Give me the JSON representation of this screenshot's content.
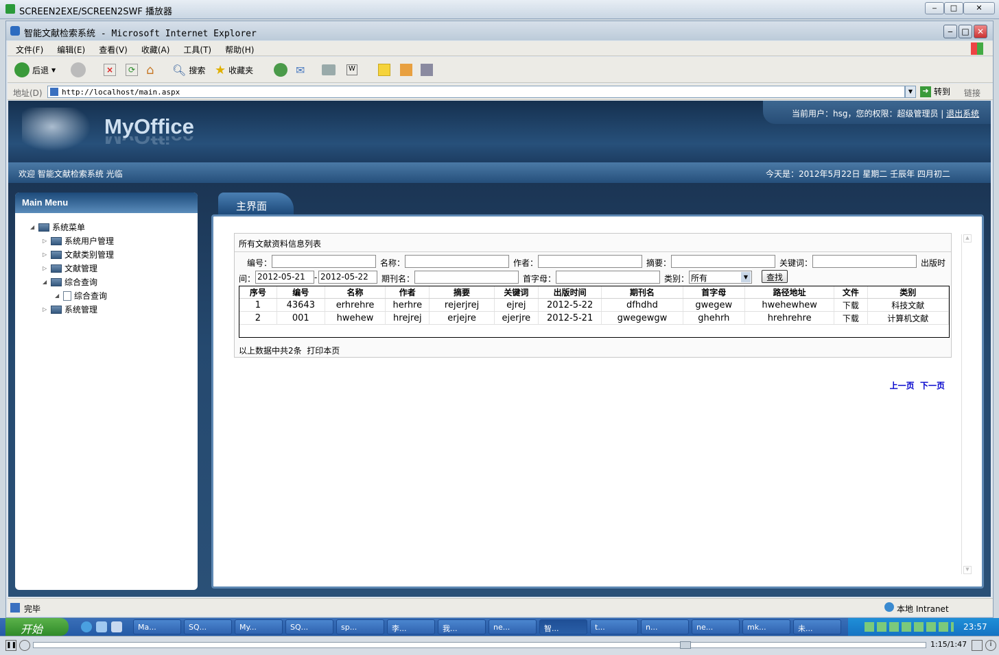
{
  "outer_window": {
    "title": "SCREEN2EXE/SCREEN2SWF 播放器"
  },
  "ie": {
    "title": "智能文献检索系统 - Microsoft Internet Explorer",
    "menu": [
      "文件(F)",
      "编辑(E)",
      "查看(V)",
      "收藏(A)",
      "工具(T)",
      "帮助(H)"
    ],
    "toolbar": {
      "back": "后退",
      "search": "搜索",
      "favorites": "收藏夹"
    },
    "address_label": "地址(D)",
    "url": "http://localhost/main.aspx",
    "go": "转到",
    "links": "链接",
    "status_left": "完毕",
    "status_zone": "本地 Intranet"
  },
  "header": {
    "logo": "MyOffice",
    "user_info": "当前用户：hsg，您的权限：超级管理员",
    "logout": "退出系统",
    "welcome": "欢迎 智能文献检索系统 光临",
    "date": "今天是：2012年5月22日 星期二 壬辰年 四月初二"
  },
  "sidebar": {
    "title": "Main Menu",
    "items": [
      {
        "label": "系统菜单"
      },
      {
        "label": "系统用户管理"
      },
      {
        "label": "文献类别管理"
      },
      {
        "label": "文献管理"
      },
      {
        "label": "综合查询"
      },
      {
        "label": "综合查询"
      },
      {
        "label": "系统管理"
      }
    ]
  },
  "main": {
    "tab": "主界面",
    "panel_title": "所有文献资料信息列表",
    "filters": {
      "id_label": "编号：",
      "name_label": "名称：",
      "author_label": "作者：",
      "abstract_label": "摘要：",
      "keyword_label": "关键词：",
      "pubtime_label": "出版时",
      "pubtime_label2": "间：",
      "date_from": "2012-05-21",
      "date_sep": "-",
      "date_to": "2012-05-22",
      "journal_label": "期刊名：",
      "initial_label": "首字母：",
      "category_label": "类别：",
      "category_value": "所有",
      "search_button": "查找"
    },
    "columns": [
      "序号",
      "编号",
      "名称",
      "作者",
      "摘要",
      "关键词",
      "出版时间",
      "期刊名",
      "首字母",
      "路径地址",
      "文件",
      "类别"
    ],
    "rows": [
      [
        "1",
        "43643",
        "erhrehre",
        "herhre",
        "rejerjrej",
        "ejrej",
        "2012-5-22",
        "dfhdhd",
        "gwegew",
        "hwehewhew",
        "下载",
        "科技文献"
      ],
      [
        "2",
        "001",
        "hwehew",
        "hrejrej",
        "erjejre",
        "ejerjre",
        "2012-5-21",
        "gwegewgw",
        "ghehrh",
        "hrehrehre",
        "下载",
        "计算机文献"
      ]
    ],
    "prev": "上一页",
    "next": "下一页",
    "summary": "以上数据中共2条",
    "print": "打印本页"
  },
  "taskbar": {
    "start": "开始",
    "tasks": [
      "Ma...",
      "SQ...",
      "My...",
      "SQ...",
      "sp...",
      "李...",
      "我...",
      "ne...",
      "智...",
      "t...",
      "n...",
      "ne...",
      "mk...",
      "未..."
    ],
    "clock": "23:57"
  },
  "player": {
    "time": "1:15/1:47",
    "progress": 0.73
  }
}
